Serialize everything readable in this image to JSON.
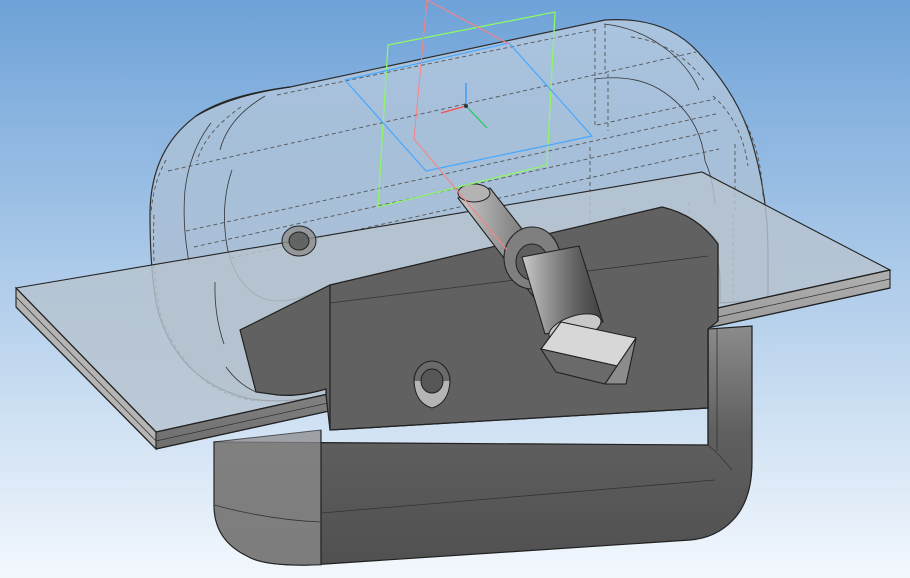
{
  "scene": {
    "background_top": "#6ea2d8",
    "background_bottom": "#f3f8fd",
    "solid_color": "#6c6c6c",
    "solid_dark": "#4f4f4f",
    "solid_light": "#a9a9a9",
    "transparent_shell": "#b8c0cc",
    "plate_top": "#a8b4c0",
    "plate_side": "#8b8b8b",
    "triad_axes_colors": {
      "x": "#ff4d4d",
      "y": "#2f8fff",
      "z": "#22c55e"
    }
  }
}
